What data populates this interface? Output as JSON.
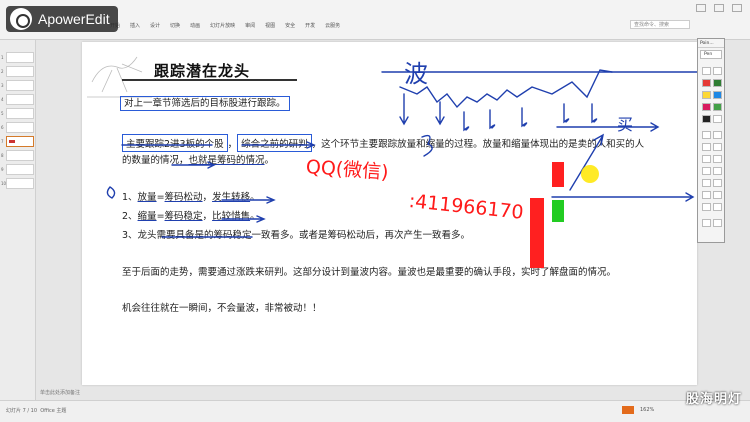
{
  "watermark": {
    "app_name": "ApowerEdit"
  },
  "ribbon": {
    "tabs": [
      "开始",
      "插入",
      "设计",
      "切换",
      "动画",
      "幻灯片放映",
      "审阅",
      "视图",
      "安全",
      "开发",
      "云服务"
    ],
    "search_placeholder": "查找命令、搜索"
  },
  "thumbnails": [
    "1",
    "2",
    "3",
    "4",
    "5",
    "6",
    "7",
    "8",
    "9",
    "10"
  ],
  "slide": {
    "title": "跟踪潜在龙头",
    "intro": "对上一章节筛选后的目标股进行跟踪。",
    "para1_box1": "主要跟踪2进3板的个股",
    "para1_sep": "，",
    "para1_box2": "综合之前的研判",
    "para1_rest": "，这个环节主要跟踪放量和缩量的过程。放量和缩量体现出的是卖的人和买的人",
    "para2_start": "的数量的情况，",
    "para2_ul": "也就是筹码的情况",
    "para2_end": "。",
    "list": [
      {
        "num": "1、",
        "a": "放量",
        "b": "=",
        "c": "筹码松动",
        "d": "，",
        "e": "发生转移",
        "f": "。"
      },
      {
        "num": "2、",
        "a": "缩量",
        "b": "=",
        "c": "筹码稳定",
        "d": "，",
        "e": "比较惜售",
        "f": "。"
      },
      {
        "num": "3、",
        "a": "龙头需要具备是的筹码稳定一致看多。或者是筹码松动后，再次产生一致看多。"
      }
    ],
    "para3": "至于后面的走势，需要通过涨跌来研判。这部分设计到量波内容。量波也是最重要的确认手段，实时了解盘面的情况。",
    "para4": "机会往往就在一瞬间，不会量波，非常被动！！",
    "overlay_qq_1": "QQ(微信)",
    "overlay_qq_2": ":411966170",
    "handwritten_top": "波",
    "handwritten_right": "买",
    "handwritten_number": "3"
  },
  "palette": {
    "title": "Poin...",
    "label": "Pen"
  },
  "status": {
    "slide_info": "幻灯片 7 / 10",
    "theme": "Office 主题",
    "note_hint": "单击此处添加备注",
    "zoom": "162%"
  },
  "brand": "股海明灯",
  "colors": {
    "accent_blue": "#1f3fae",
    "ink_red": "#ff1a1a",
    "bar_red": "#ff2020",
    "bar_green": "#22cc22",
    "highlight": "#ffe600"
  }
}
